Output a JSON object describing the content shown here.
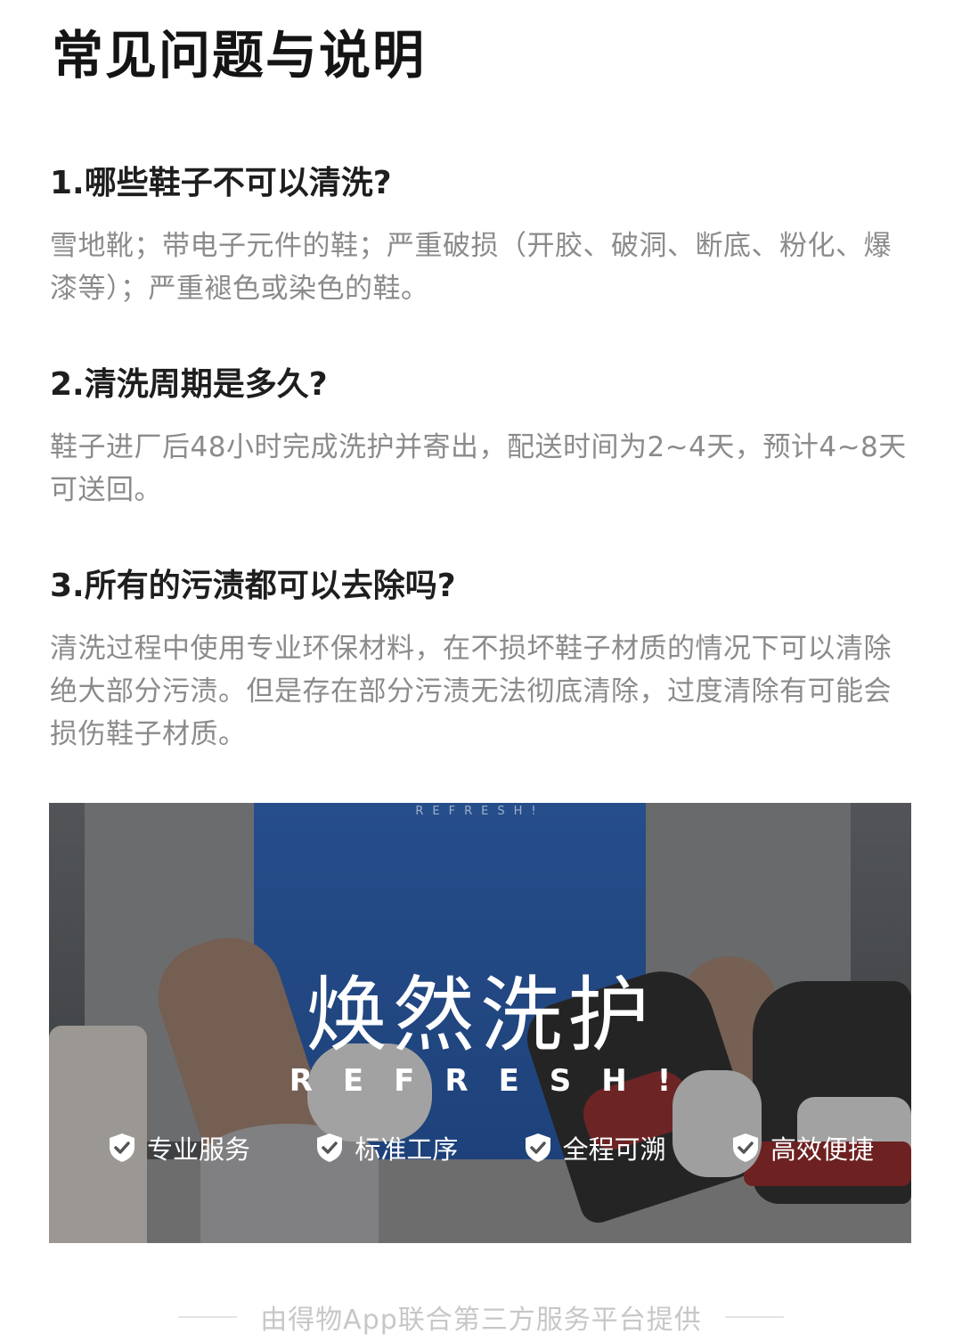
{
  "page": {
    "title": "常见问题与说明"
  },
  "faqs": [
    {
      "question": "1.哪些鞋子不可以清洗?",
      "answer": "雪地靴；带电子元件的鞋；严重破损（开胶、破洞、断底、粉化、爆漆等）；严重褪色或染色的鞋。"
    },
    {
      "question": "2.清洗周期是多久?",
      "answer": "鞋子进厂后48小时完成洗护并寄出，配送时间为2~4天，预计4~8天可送回。"
    },
    {
      "question": "3.所有的污渍都可以去除吗?",
      "answer": "清洗过程中使用专业环保材料，在不损坏鞋子材质的情况下可以清除绝大部分污渍。但是存在部分污渍无法彻底清除，过度清除有可能会损伤鞋子材质。"
    }
  ],
  "banner": {
    "top_mark": "REFRESH!",
    "brand_cn": "焕然洗护",
    "brand_en": "REFRESH!",
    "features": [
      {
        "icon": "shield-check-icon",
        "label": "专业服务"
      },
      {
        "icon": "shield-check-icon",
        "label": "标准工序"
      },
      {
        "icon": "shield-check-icon",
        "label": "全程可溯"
      },
      {
        "icon": "shield-check-icon",
        "label": "高效便捷"
      }
    ]
  },
  "footer": {
    "text": "由得物App联合第三方服务平台提供"
  },
  "colors": {
    "question": "#1e1e1e",
    "answer": "#8b8b8b",
    "apron_blue": "#2d64b8",
    "footer_text": "#c7c7c7"
  }
}
